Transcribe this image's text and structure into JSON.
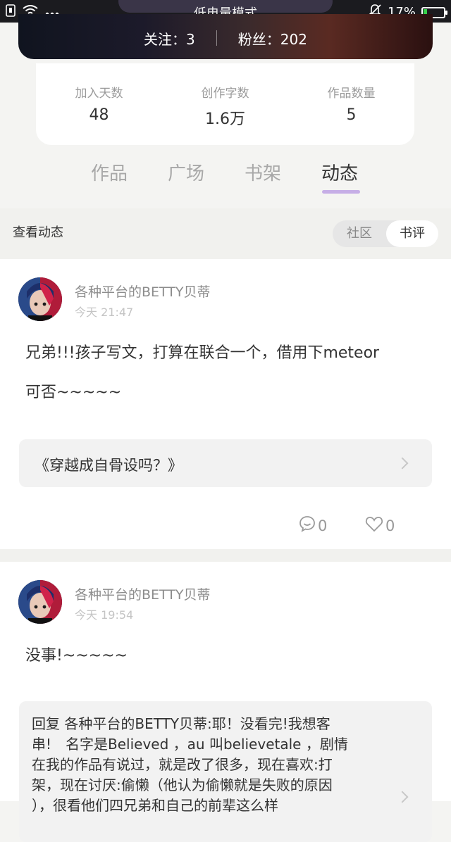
{
  "status_bar": {
    "center_text": "低电量模式",
    "battery_text": "17%",
    "battery_level": 0.17
  },
  "header": {
    "following_label": "关注：3",
    "followers_label": "粉丝：202"
  },
  "stats": [
    {
      "label": "加入天数",
      "value": "48"
    },
    {
      "label": "创作字数",
      "value": "1.6万"
    },
    {
      "label": "作品数量",
      "value": "5"
    }
  ],
  "tabs": [
    {
      "label": "作品",
      "active": false
    },
    {
      "label": "广场",
      "active": false
    },
    {
      "label": "书架",
      "active": false
    },
    {
      "label": "动态",
      "active": true
    }
  ],
  "subheader": {
    "title": "查看动态",
    "toggle": [
      "社区",
      "书评"
    ],
    "toggle_selected": "书评"
  },
  "posts": [
    {
      "author": "各种平台的BETTY贝蒂",
      "time": "今天 21:47",
      "text_line1": "兄弟!!!孩子写文，打算在联合一个，借用下meteor",
      "text_line2": "可否~~~~~",
      "link": "《穿越成自骨设吗？》",
      "comments": "0",
      "likes": "0"
    },
    {
      "author": "各种平台的BETTY贝蒂",
      "time": "今天 19:54",
      "text": "没事!~~~~~",
      "reply_lines": [
        "回复 各种平台的BETTY贝蒂:耶！没看完!我想客",
        "串!　名字是Believed ，au 叫believetale ，剧情",
        "在我的作品有说过，就是改了很多，现在喜欢:打",
        "架，现在讨厌:偷懒（他认为偷懒就是失败的原因",
        "），很看他们四兄弟和自己的前辈这么样"
      ]
    }
  ]
}
